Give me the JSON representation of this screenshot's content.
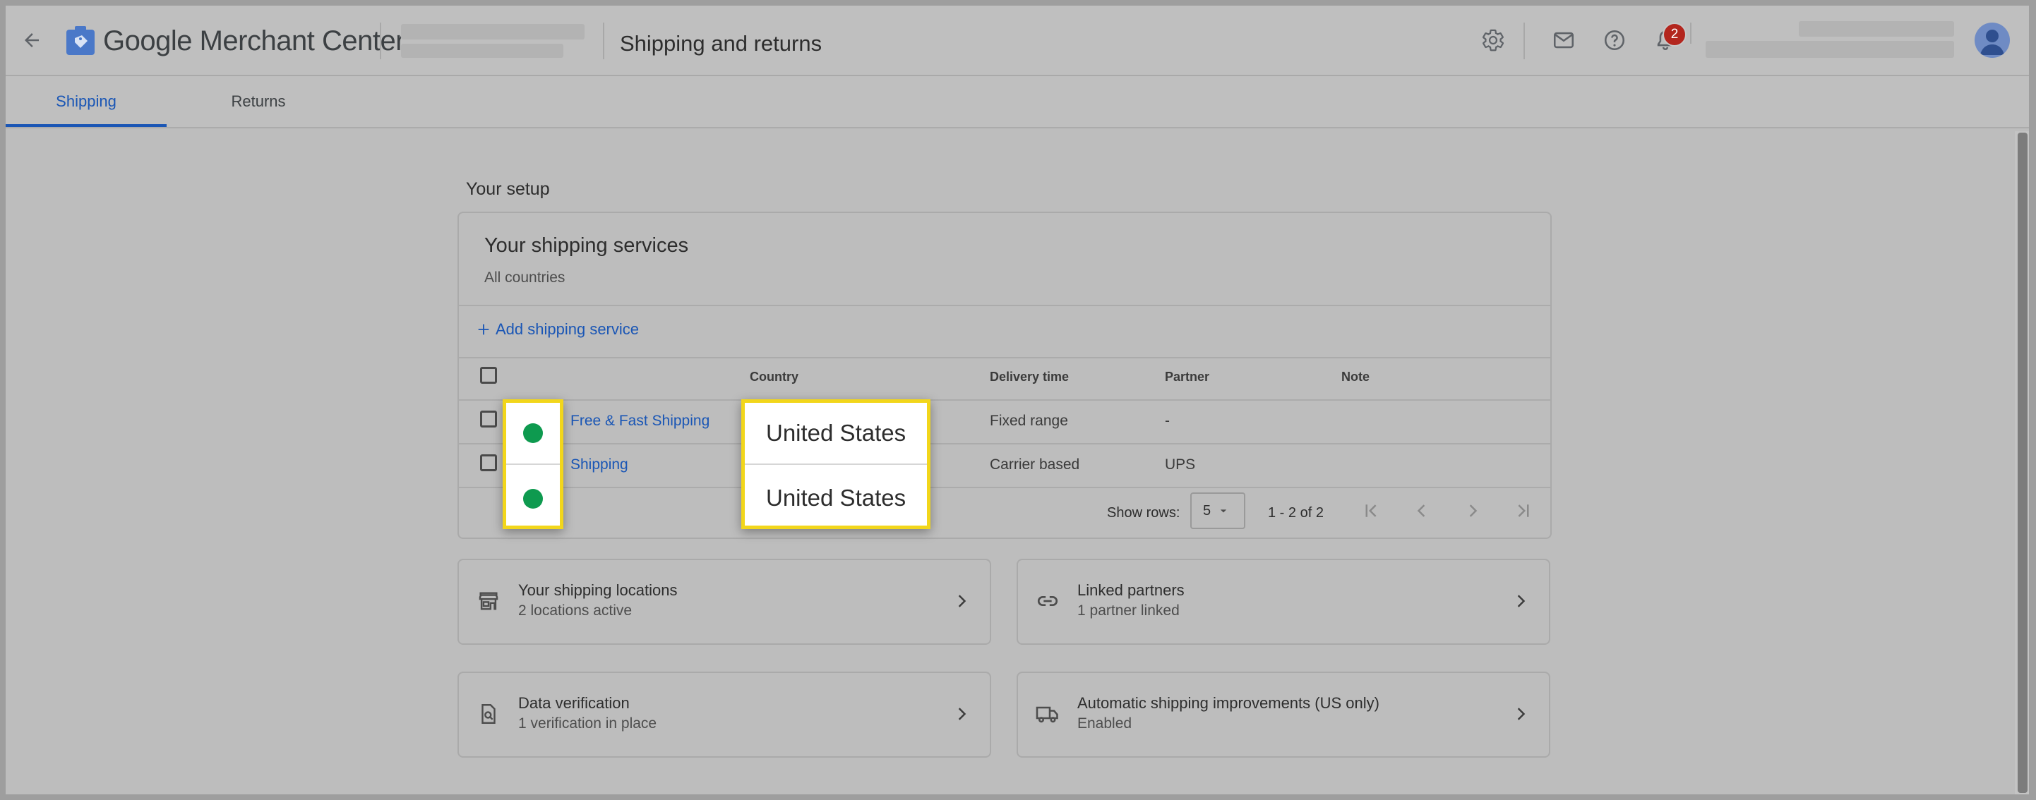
{
  "header": {
    "brand": "Google Merchant Center",
    "page_title": "Shipping and returns",
    "notification_count": "2"
  },
  "tabs": [
    {
      "label": "Shipping",
      "active": true
    },
    {
      "label": "Returns",
      "active": false
    }
  ],
  "setup": {
    "title": "Your setup",
    "services": {
      "title": "Your shipping services",
      "subtitle": "All countries",
      "add_label": "Add shipping service",
      "columns": [
        "Country",
        "Delivery time",
        "Partner",
        "Note"
      ],
      "rows": [
        {
          "name": "Free & Fast Shipping",
          "country": "United States",
          "delivery": "Fixed range",
          "partner": "-",
          "status": "active"
        },
        {
          "name": "Shipping",
          "country": "United States",
          "delivery": "Carrier based",
          "partner": "UPS",
          "status": "active"
        }
      ],
      "pagination": {
        "rows_label": "Show rows:",
        "rows_value": "5",
        "range": "1 - 2 of 2"
      }
    },
    "cards": [
      {
        "title": "Your shipping locations",
        "subtitle": "2 locations active",
        "icon": "store-icon"
      },
      {
        "title": "Linked partners",
        "subtitle": "1 partner linked",
        "icon": "link-icon"
      },
      {
        "title": "Data verification",
        "subtitle": "1 verification in place",
        "icon": "document-search-icon"
      },
      {
        "title": "Automatic shipping improvements (US only)",
        "subtitle": "Enabled",
        "icon": "truck-icon"
      }
    ]
  },
  "colors": {
    "accent": "#1a56b5",
    "highlight": "#f2d61b",
    "status_active": "#0e9a4f",
    "badge": "#b3261e"
  }
}
